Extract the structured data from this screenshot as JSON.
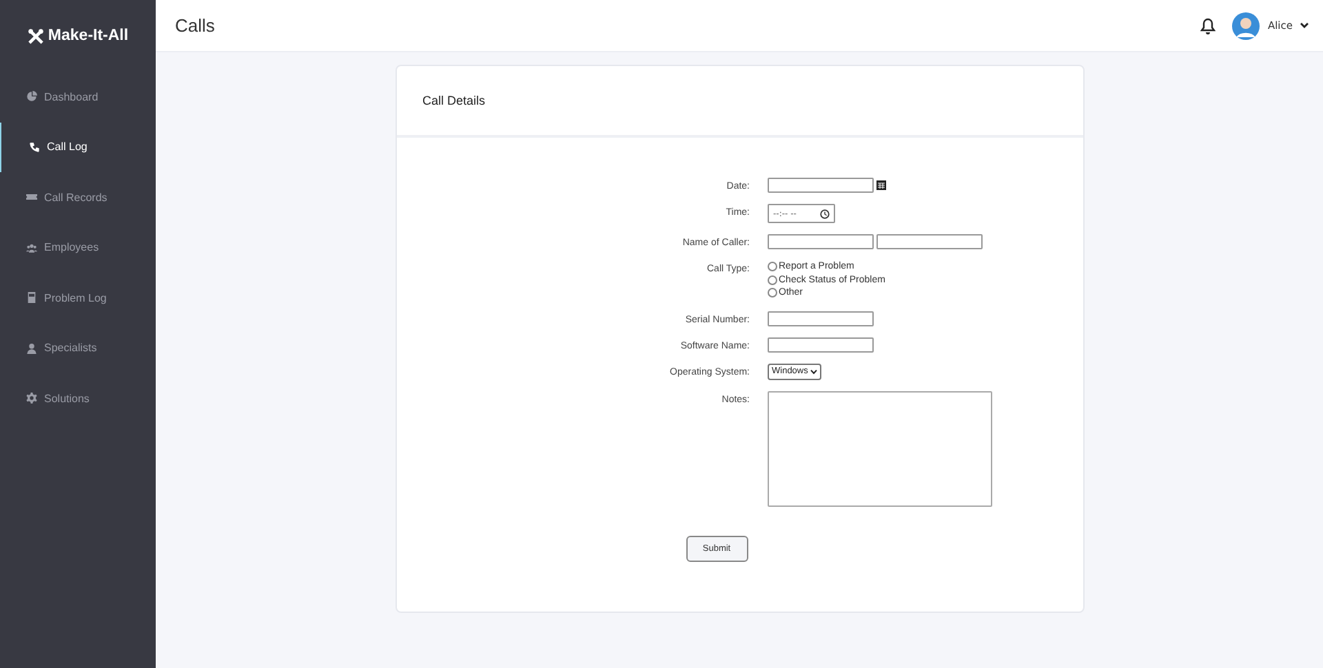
{
  "brand": {
    "name": "Make-It-All"
  },
  "sidebar": {
    "items": [
      {
        "label": "Dashboard",
        "selected": false
      },
      {
        "label": "Call Log",
        "selected": true
      },
      {
        "label": "Call Records",
        "selected": false
      },
      {
        "label": "Employees",
        "selected": false
      },
      {
        "label": "Problem Log",
        "selected": false
      },
      {
        "label": "Specialists",
        "selected": false
      },
      {
        "label": "Solutions",
        "selected": false
      }
    ]
  },
  "header": {
    "title": "Calls",
    "user": "Alice"
  },
  "card": {
    "title": "Call Details",
    "fields": [
      {
        "kind": "date",
        "label": "Date:"
      },
      {
        "kind": "time",
        "label": "Time:",
        "placeholder": "--:-- --"
      },
      {
        "kind": "text2",
        "label": "Name of Caller:"
      },
      {
        "kind": "radio",
        "label": "Call Type:",
        "options": [
          {
            "label": "Report a Problem",
            "selected": false
          },
          {
            "label": "Check Status of Problem",
            "selected": false
          },
          {
            "label": "Other",
            "selected": false
          }
        ]
      },
      {
        "kind": "text",
        "label": "Serial Number:"
      },
      {
        "kind": "text",
        "label": "Software Name:"
      },
      {
        "kind": "select",
        "label": "Operating System:",
        "value": "Windows"
      },
      {
        "kind": "textarea",
        "label": "Notes:"
      }
    ],
    "submit": "Submit"
  }
}
